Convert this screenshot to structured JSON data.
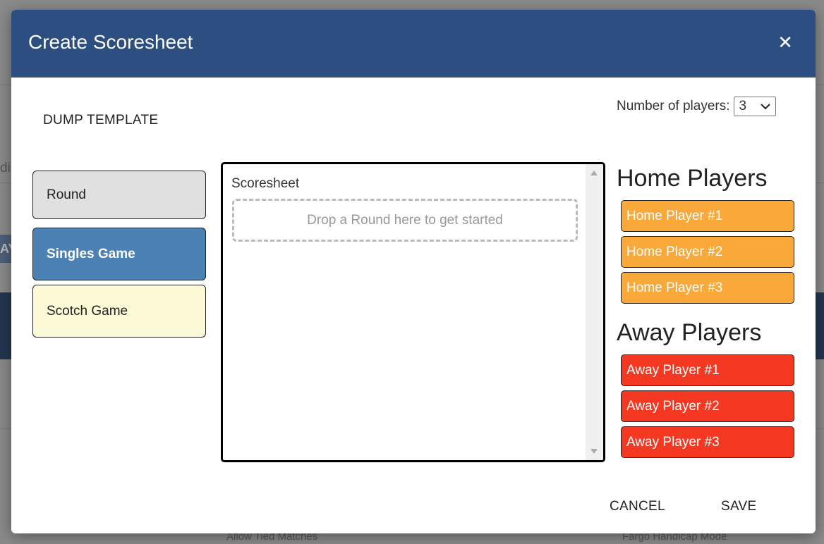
{
  "background": {
    "partial_left": "di",
    "partial_button": "AY",
    "footer_left": "Allow Tied Matches",
    "footer_right": "Fargo Handicap Mode"
  },
  "modal": {
    "title": "Create Scoresheet",
    "close_icon": "close-icon",
    "dump_template": "DUMP TEMPLATE",
    "num_players_label": "Number of players:",
    "num_players_value": "3",
    "palette": [
      {
        "label": "Round",
        "color": "#e0e0e0"
      },
      {
        "label": "Singles Game",
        "color": "#4b82b3"
      },
      {
        "label": "Scotch Game",
        "color": "#fcf9d7"
      }
    ],
    "scoresheet": {
      "label": "Scoresheet",
      "drop_placeholder": "Drop a Round here to get started"
    },
    "home": {
      "heading": "Home Players",
      "color": "#f8a93a",
      "players": [
        "Home Player #1",
        "Home Player #2",
        "Home Player #3"
      ]
    },
    "away": {
      "heading": "Away Players",
      "color": "#f53822",
      "players": [
        "Away Player #1",
        "Away Player #2",
        "Away Player #3"
      ]
    },
    "cancel": "CANCEL",
    "save": "SAVE"
  }
}
